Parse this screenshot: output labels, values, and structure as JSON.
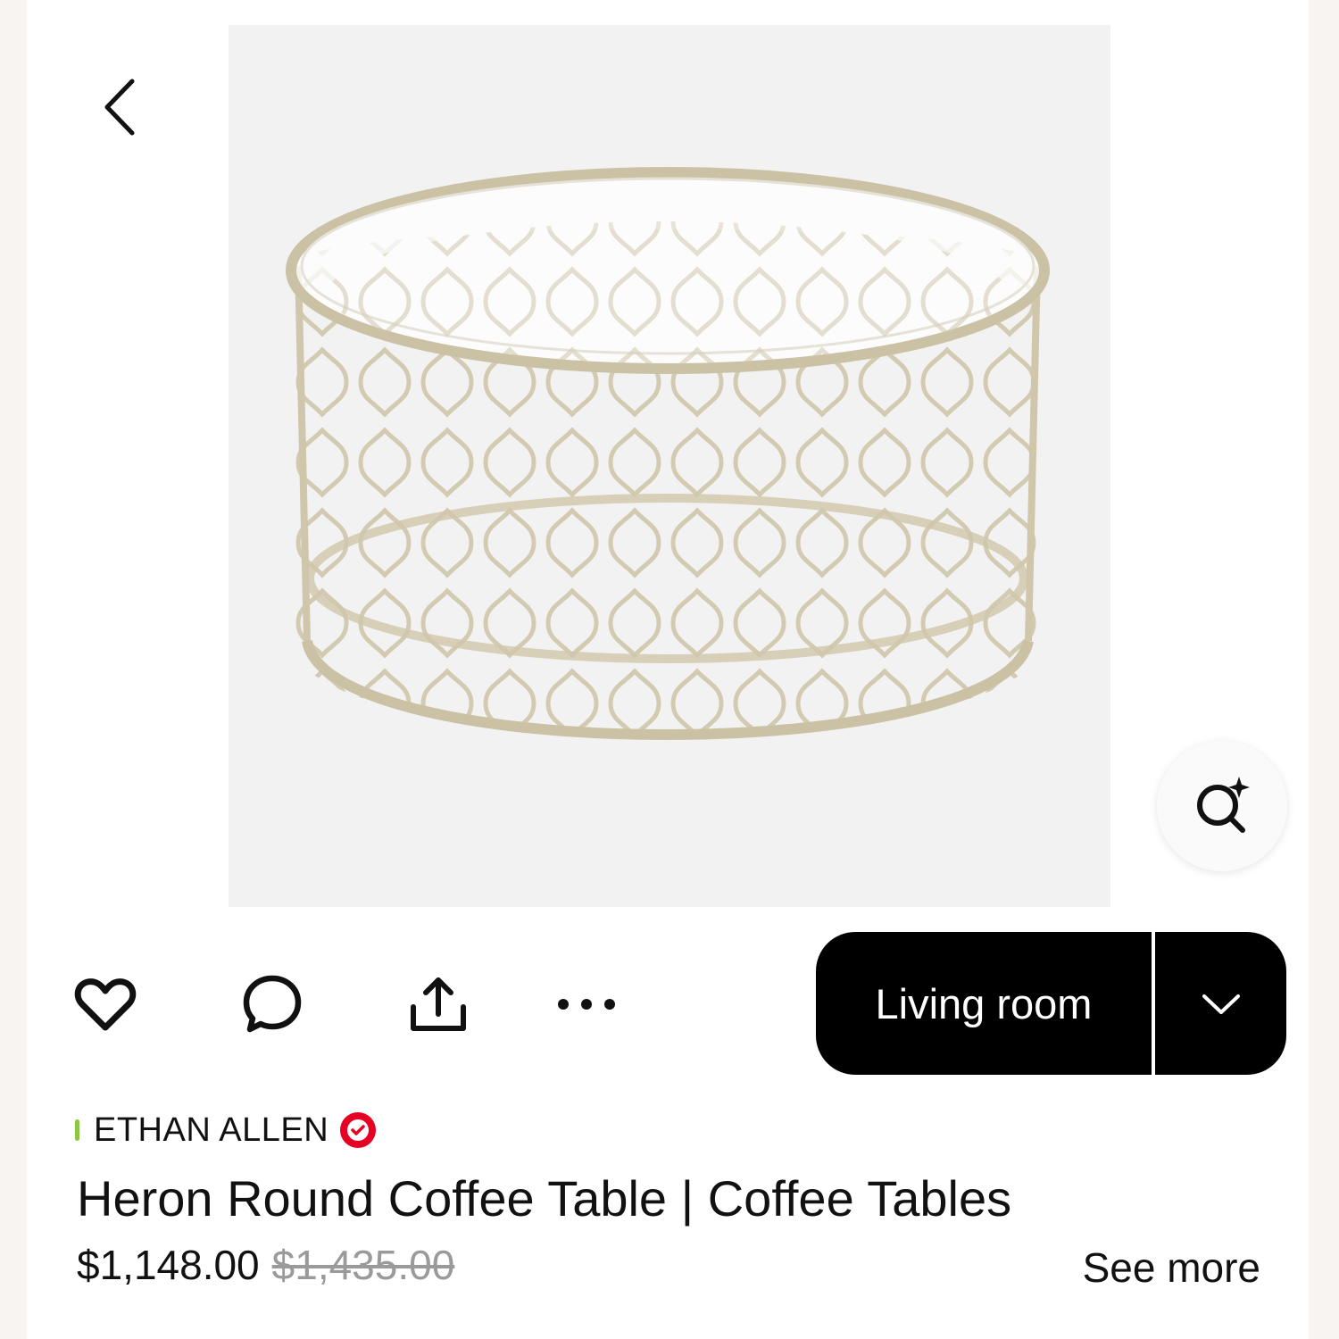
{
  "product": {
    "image_alt": "Heron Round Coffee Table",
    "brand": "ETHAN ALLEN",
    "title": "Heron Round Coffee Table | Coffee Tables",
    "price": "$1,148.00",
    "original_price": "$1,435.00"
  },
  "board": {
    "selected": "Living room"
  },
  "actions": {
    "see_more": "See more"
  },
  "icons": {
    "back": "chevron-left-icon",
    "visual_search": "visual-search-icon",
    "like": "heart-icon",
    "comment": "comment-icon",
    "share": "share-icon",
    "more": "more-icon",
    "dropdown": "chevron-down-icon",
    "verified": "verified-check-icon"
  },
  "colors": {
    "verified": "#e60023",
    "brand_mark": "#8dc63f",
    "button": "#000000"
  }
}
